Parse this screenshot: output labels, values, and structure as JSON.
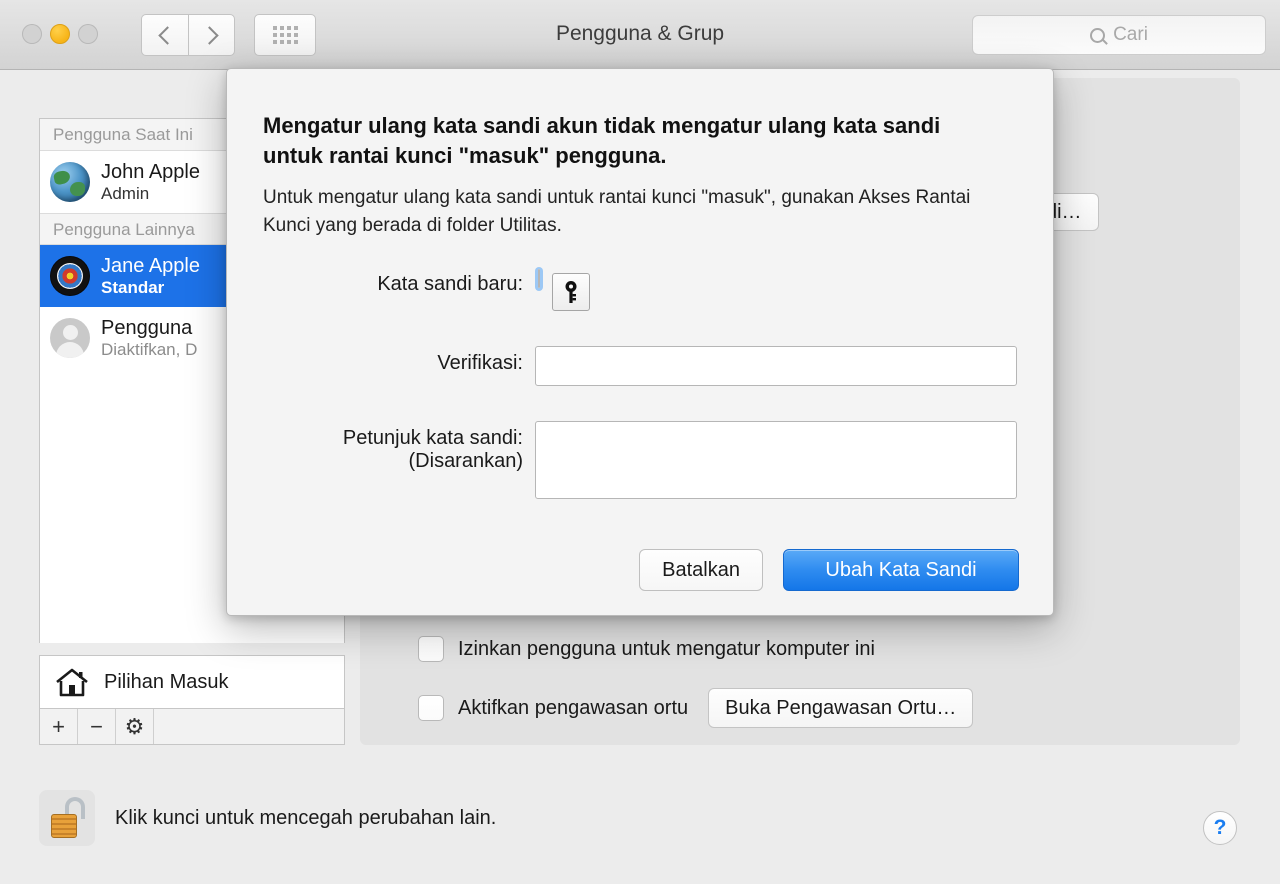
{
  "window": {
    "title": "Pengguna & Grup",
    "traffic_lights": [
      "close",
      "minimize",
      "maximize"
    ],
    "nav": {
      "back": "back-chevron",
      "forward": "forward-chevron",
      "show_all": "grid-icon"
    },
    "search": {
      "placeholder": "Cari",
      "value": "",
      "icon": "search-icon"
    }
  },
  "sidebar": {
    "group_current": "Pengguna Saat Ini",
    "group_other": "Pengguna Lainnya",
    "users": [
      {
        "name": "John Apple",
        "role": "Admin",
        "avatar": "globe-avatar",
        "selected": false
      },
      {
        "name": "Jane Apple",
        "role": "Standar",
        "avatar": "target-avatar",
        "selected": true
      },
      {
        "name": "Pengguna",
        "role": "Diaktifkan, D",
        "avatar": "person-avatar",
        "selected": false
      }
    ],
    "login_options": {
      "label": "Pilihan Masuk",
      "icon": "house-icon"
    },
    "toolbar": {
      "add": "+",
      "remove": "−",
      "settings": "⚙"
    }
  },
  "main": {
    "reset_password_button": "ata Sandi…",
    "checkboxes": [
      {
        "label": "Izinkan pengguna untuk mengatur komputer ini",
        "checked": false
      },
      {
        "label": "Aktifkan pengawasan ortu",
        "checked": false
      }
    ],
    "parental_button": "Buka Pengawasan Ortu…"
  },
  "footer": {
    "lock_text": "Klik kunci untuk mencegah perubahan lain.",
    "lock_icon": "unlocked-padlock-icon",
    "help_label": "?"
  },
  "dialog": {
    "title": "Mengatur ulang kata sandi akun tidak mengatur ulang kata sandi untuk rantai kunci \"masuk\" pengguna.",
    "body": "Untuk mengatur ulang kata sandi untuk rantai kunci \"masuk\", gunakan Akses Rantai Kunci yang berada di folder Utilitas.",
    "fields": {
      "new_password_label": "Kata sandi baru:",
      "new_password_value": "",
      "verify_label": "Verifikasi:",
      "verify_value": "",
      "hint_label": "Petunjuk kata sandi:",
      "hint_sub_label": "(Disarankan)",
      "hint_value": "",
      "key_button_icon": "key-icon"
    },
    "buttons": {
      "cancel": "Batalkan",
      "confirm": "Ubah Kata Sandi"
    },
    "accent_color": "#1476e8",
    "focus_ring_color": "#9cc8f5"
  }
}
